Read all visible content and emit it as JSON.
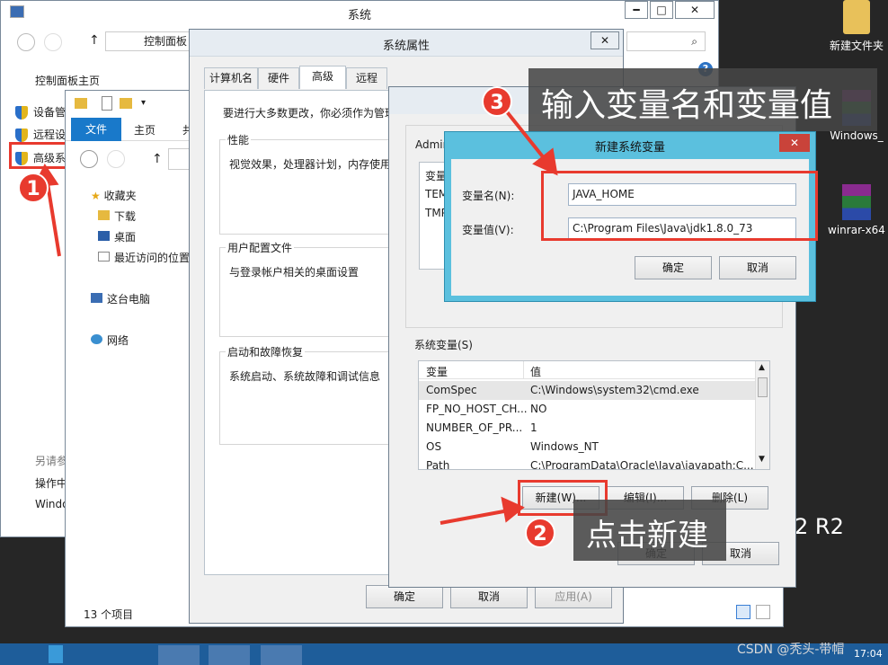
{
  "desktop": {
    "icons": [
      {
        "label": "新建文件夹"
      },
      {
        "label": "Windows_"
      },
      {
        "label": "winrar-x64"
      }
    ],
    "os_text": "2 R2",
    "watermark": "CSDN @秃头-带帽"
  },
  "system_window": {
    "title": "系统",
    "minimize": "━",
    "maximize": "□",
    "close": "✕",
    "address": "控制面板",
    "search_icon": "⌕",
    "home_link": "控制面板主页",
    "nav": [
      {
        "label": "设备管"
      },
      {
        "label": "远程设"
      },
      {
        "label": "高级系"
      }
    ],
    "see_also": "另请参",
    "see_also_items": [
      "操作中",
      "Windo"
    ]
  },
  "explorer": {
    "ribbon_tabs": [
      "文件",
      "主页",
      "共"
    ],
    "tree": [
      {
        "label": "收藏夹"
      },
      {
        "label": "下载"
      },
      {
        "label": "桌面"
      },
      {
        "label": "最近访问的位置"
      },
      {
        "label": "这台电脑"
      },
      {
        "label": "网络"
      }
    ],
    "status": "13 个项目"
  },
  "sysprops": {
    "title": "系统属性",
    "close": "✕",
    "tabs": [
      "计算机名",
      "硬件",
      "高级",
      "远程"
    ],
    "intro": "要进行大多数更改，你必须作为管理",
    "groups": [
      {
        "title": "性能",
        "desc": "视觉效果，处理器计划，内存使用"
      },
      {
        "title": "用户配置文件",
        "desc": "与登录帐户相关的桌面设置"
      },
      {
        "title": "启动和故障恢复",
        "desc": "系统启动、系统故障和调试信息"
      }
    ],
    "ok": "确定",
    "cancel": "取消",
    "apply": "应用(A)"
  },
  "envvars": {
    "user_label": "Admin",
    "user_header": "变量",
    "user_rows": [
      "TEM",
      "TMP"
    ],
    "sys_label": "系统变量(S)",
    "col_var": "变量",
    "col_val": "值",
    "rows": [
      {
        "name": "ComSpec",
        "value": "C:\\Windows\\system32\\cmd.exe"
      },
      {
        "name": "FP_NO_HOST_CH...",
        "value": "NO"
      },
      {
        "name": "NUMBER_OF_PR...",
        "value": "1"
      },
      {
        "name": "OS",
        "value": "Windows_NT"
      },
      {
        "name": "Path",
        "value": "C:\\ProgramData\\Oracle\\Java\\javapath;C..."
      }
    ],
    "new_btn": "新建(W)...",
    "edit_btn": "编辑(I)...",
    "delete_btn": "删除(L)",
    "ok": "确定",
    "cancel": "取消"
  },
  "newvar": {
    "title": "新建系统变量",
    "close": "✕",
    "name_label": "变量名(N):",
    "name_value": "JAVA_HOME",
    "value_label": "变量值(V):",
    "value_value": "C:\\Program Files\\Java\\jdk1.8.0_73",
    "ok": "确定",
    "cancel": "取消"
  },
  "annotations": {
    "step1": "1",
    "step2": "2",
    "step2_text": "点击新建",
    "step3": "3",
    "step3_text": "输入变量名和变量值"
  },
  "taskbar": {
    "clock": "17:04"
  },
  "colors": {
    "accent_red": "#e83a2e",
    "dialog_blue": "#5bc0de",
    "ribbon_blue": "#1979ca"
  }
}
